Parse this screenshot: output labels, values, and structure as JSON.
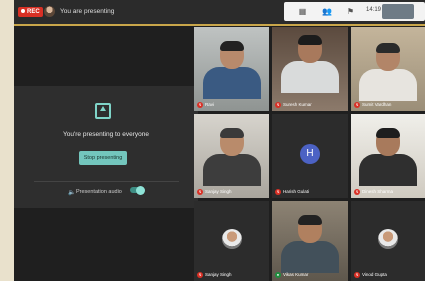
{
  "topbar": {
    "rec_label": "REC",
    "presenting_label": "You are presenting",
    "clock": "14:19"
  },
  "present_panel": {
    "message": "You're presenting to everyone",
    "stop_button": "Stop presenting",
    "audio_label": "Presentation audio",
    "audio_on": true
  },
  "participants": [
    {
      "name": "Ravi",
      "mic": "muted"
    },
    {
      "name": "Suresh Kumar",
      "mic": "muted"
    },
    {
      "name": "Sumit Vardhan",
      "mic": "muted"
    },
    {
      "name": "Sanjay Singh",
      "mic": "muted"
    },
    {
      "name": "Harish Gulati",
      "mic": "muted",
      "initial": "H"
    },
    {
      "name": "Dinesh Sharma",
      "mic": "muted"
    },
    {
      "name": "Sanjay Singh",
      "mic": "muted"
    },
    {
      "name": "Vikas Kumar",
      "mic": "on"
    },
    {
      "name": "Vinod Gupta",
      "mic": "muted"
    }
  ],
  "colors": {
    "accent": "#73c6bd",
    "mic_muted": "#d93025",
    "mic_on": "#1e8e3e",
    "avatar_bg": "#4c62c4"
  }
}
